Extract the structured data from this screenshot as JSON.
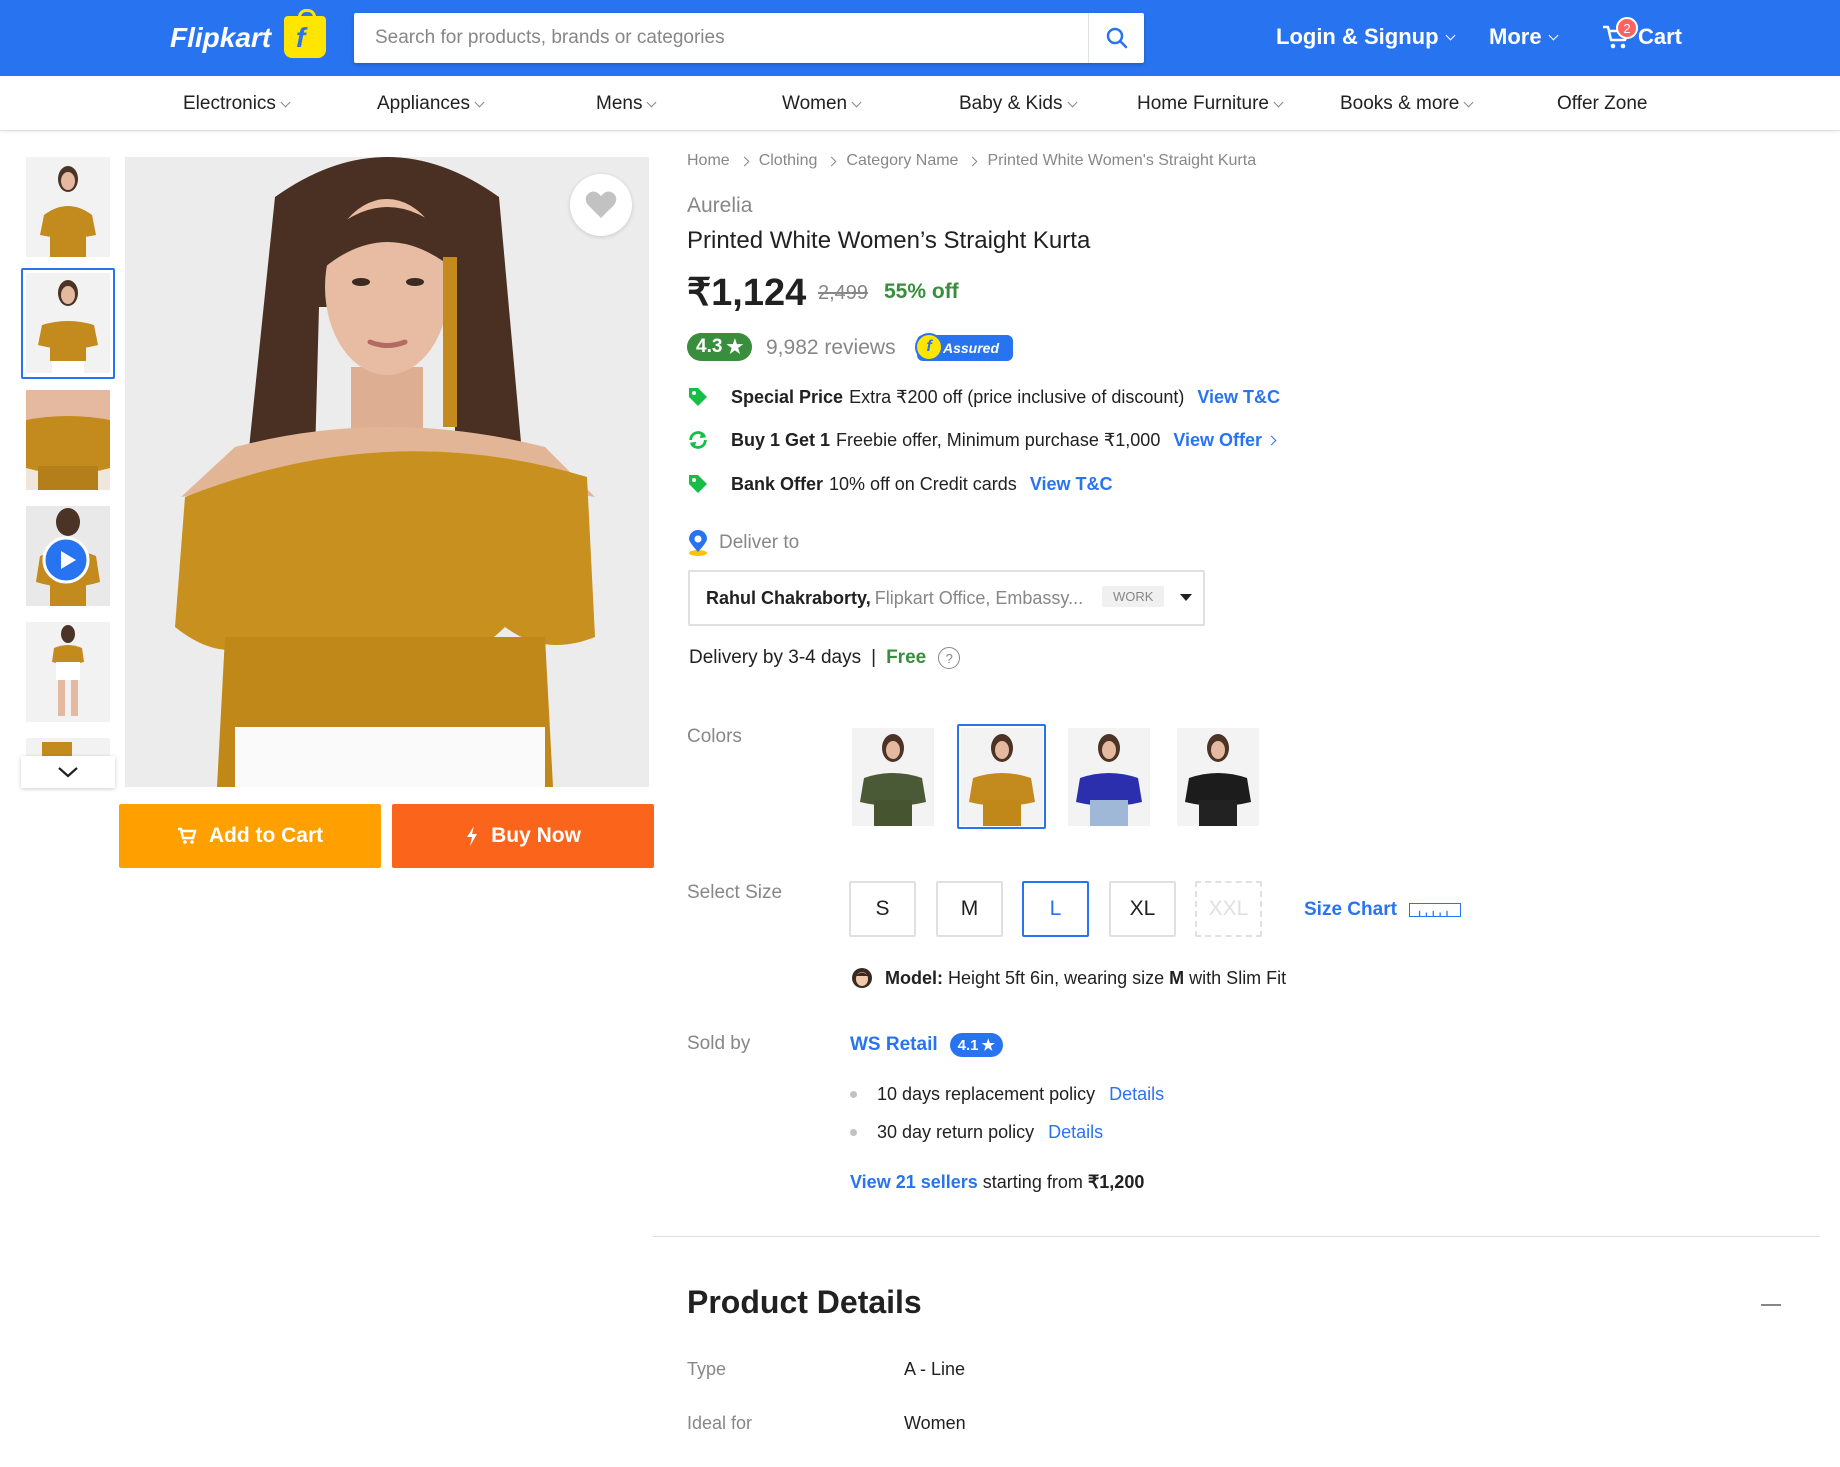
{
  "header": {
    "logo_text": "Flipkart",
    "search_placeholder": "Search for products, brands or categories",
    "login_label": "Login & Signup",
    "more_label": "More",
    "cart_label": "Cart",
    "cart_count": "2",
    "brand_color": "#2874f0"
  },
  "nav": {
    "items": [
      {
        "label": "Electronics"
      },
      {
        "label": "Appliances"
      },
      {
        "label": "Mens"
      },
      {
        "label": "Women"
      },
      {
        "label": "Baby & Kids"
      },
      {
        "label": "Home Furniture"
      },
      {
        "label": "Books & more"
      },
      {
        "label": "Offer Zone"
      }
    ]
  },
  "gallery": {
    "selected_thumb": 2,
    "wishlist_icon": "heart-icon"
  },
  "actions": {
    "add_to_cart": "Add to Cart",
    "buy_now": "Buy Now"
  },
  "breadcrumbs": [
    "Home",
    "Clothing",
    "Category Name",
    "Printed White Women's Straight Kurta"
  ],
  "product": {
    "brand": "Aurelia",
    "title": "Printed White Women’s Straight Kurta",
    "price": "₹1,124",
    "mrp": "2,499",
    "discount": "55% off",
    "rating": "4.3",
    "reviews": "9,982 reviews",
    "assured": "Assured"
  },
  "offers": [
    {
      "title": "Special Price",
      "text": "Extra ₹200 off (price inclusive of discount)",
      "link": "View T&C",
      "icon": "tag-icon"
    },
    {
      "title": "Buy 1 Get 1",
      "text": "Freebie offer, Minimum purchase ₹1,000",
      "link": "View Offer",
      "icon": "refresh-icon"
    },
    {
      "title": "Bank Offer",
      "text": "10% off on Credit cards",
      "link": "View T&C",
      "icon": "tag-icon"
    }
  ],
  "delivery": {
    "deliver_to": "Deliver to",
    "name": "Rahul Chakraborty,",
    "address": "Flipkart Office, Embassy...",
    "tag": "WORK",
    "by": "Delivery by 3-4 days",
    "sep": "|",
    "charge": "Free",
    "help": "?"
  },
  "colors": {
    "label": "Colors",
    "options": [
      "olive",
      "mustard",
      "blue",
      "black"
    ],
    "selected": "mustard"
  },
  "sizes": {
    "label": "Select Size",
    "options": [
      "S",
      "M",
      "L",
      "XL",
      "XXL"
    ],
    "selected": "L",
    "unavailable": "XXL",
    "chart_label": "Size Chart"
  },
  "model": {
    "label": "Model:",
    "text1": "Height 5ft 6in, wearing size",
    "size": "M",
    "text2": "with Slim Fit"
  },
  "seller": {
    "label": "Sold by",
    "name": "WS Retail",
    "rating": "4.1",
    "policies": [
      {
        "text": "10 days replacement policy",
        "link": "Details"
      },
      {
        "text": "30 day return policy",
        "link": "Details"
      }
    ],
    "more_link": "View 21 sellers",
    "more_text": "starting from",
    "more_price": "₹1,200"
  },
  "details": {
    "heading": "Product Details",
    "rows": [
      {
        "key": "Type",
        "value": "A - Line"
      },
      {
        "key": "Ideal for",
        "value": "Women"
      }
    ]
  }
}
